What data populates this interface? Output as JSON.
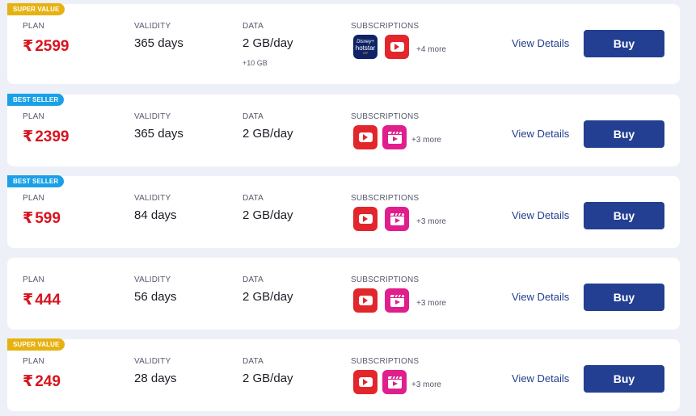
{
  "labels": {
    "plan": "PLAN",
    "validity": "VALIDITY",
    "data": "DATA",
    "subscriptions": "SUBSCRIPTIONS",
    "view_details": "View Details",
    "buy": "Buy"
  },
  "plans": [
    {
      "badge": "SUPER VALUE",
      "price": "2599",
      "validity": "365 days",
      "data": "2 GB/day",
      "data_extra": "+10 GB",
      "apps": [
        "hotstar-icon",
        "youtube-icon"
      ],
      "more": "+4 more"
    },
    {
      "badge": "BEST SELLER",
      "price": "2399",
      "validity": "365 days",
      "data": "2 GB/day",
      "apps": [
        "youtube-icon",
        "film-icon"
      ],
      "more": "+3 more"
    },
    {
      "badge": "BEST SELLER",
      "price": "599",
      "validity": "84 days",
      "data": "2 GB/day",
      "apps": [
        "youtube-icon",
        "film-icon"
      ],
      "more": "+3 more"
    },
    {
      "price": "444",
      "validity": "56 days",
      "data": "2 GB/day",
      "apps": [
        "youtube-icon",
        "film-icon"
      ],
      "more": "+3 more"
    },
    {
      "badge": "SUPER VALUE",
      "price": "249",
      "validity": "28 days",
      "data": "2 GB/day",
      "apps": [
        "youtube-icon",
        "film-icon"
      ],
      "more": "+3 more"
    }
  ],
  "hotstar_logo": {
    "line1": "Disney+",
    "line2": "hotstar",
    "line3": "VIP"
  },
  "colors": {
    "price": "#d8141f",
    "buy_button": "#233f91",
    "super_value_badge": "#e7b211",
    "best_seller_badge": "#1aa0e6",
    "youtube": "#e2262c",
    "film": "#e01e8c",
    "hotstar": "#0f2366"
  }
}
